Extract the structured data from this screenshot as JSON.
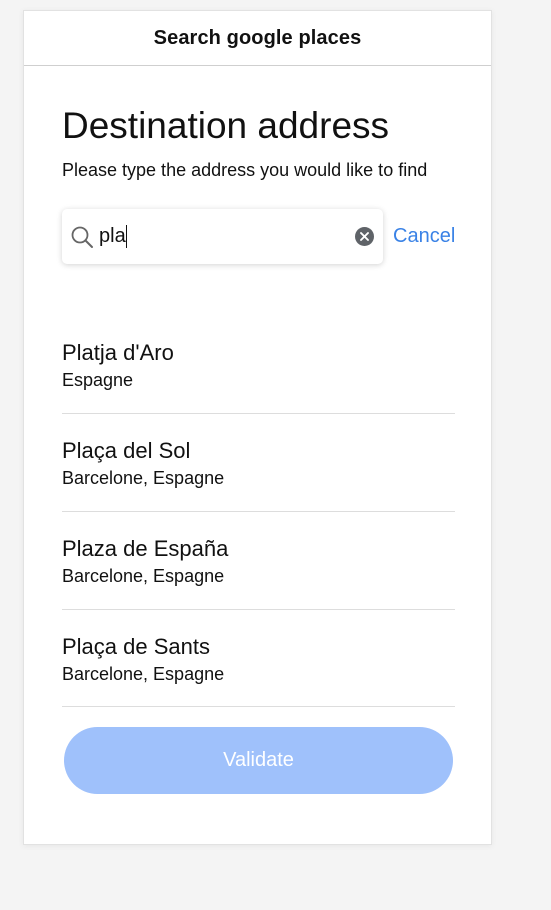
{
  "header": {
    "title": "Search google places"
  },
  "page": {
    "title": "Destination address",
    "subtitle": "Please type the address you would like to find"
  },
  "search": {
    "value": "pla",
    "icon": "search-icon",
    "clear_icon": "clear-icon",
    "cancel_label": "Cancel"
  },
  "results": [
    {
      "name": "Platja d'Aro",
      "location": "Espagne"
    },
    {
      "name": "Plaça del Sol",
      "location": "Barcelone, Espagne"
    },
    {
      "name": "Plaza de España",
      "location": "Barcelone, Espagne"
    },
    {
      "name": "Plaça de Sants",
      "location": "Barcelone, Espagne"
    }
  ],
  "footer": {
    "validate_label": "Validate"
  },
  "colors": {
    "accent": "#3a82e6",
    "button_disabled": "#9fc1fb"
  }
}
